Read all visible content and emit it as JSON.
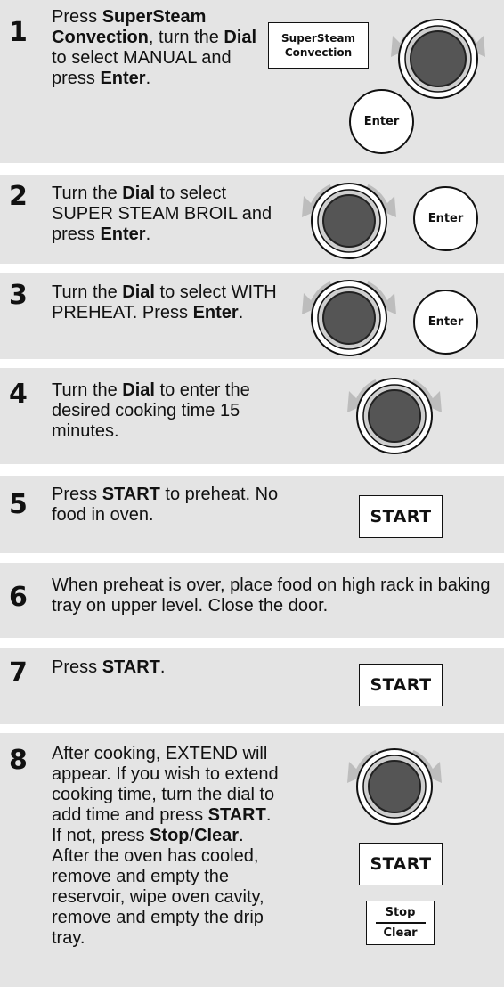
{
  "steps": [
    {
      "number": "1",
      "parts": [
        "Press ",
        "SuperSteam Convection",
        ", turn the ",
        "Dial",
        " to select MANUAL and press ",
        "Enter",
        "."
      ]
    },
    {
      "number": "2",
      "parts": [
        "Turn the ",
        "Dial",
        " to select SUPER STEAM BROIL and press ",
        "Enter",
        "."
      ]
    },
    {
      "number": "3",
      "parts": [
        "Turn the ",
        "Dial",
        " to select WITH PREHEAT. Press ",
        "Enter",
        "."
      ]
    },
    {
      "number": "4",
      "parts": [
        "Turn the ",
        "Dial",
        " to enter the desired cooking time 15 minutes."
      ]
    },
    {
      "number": "5",
      "parts": [
        "Press ",
        "START",
        " to preheat. No food in oven."
      ]
    },
    {
      "number": "6",
      "parts": [
        "When preheat is over, place food on high rack in baking tray on upper level. Close the door."
      ]
    },
    {
      "number": "7",
      "parts": [
        "Press ",
        "START",
        "."
      ]
    },
    {
      "number": "8",
      "parts": [
        "After cooking, EXTEND will appear. If you wish to extend cooking time, turn the dial to add time and press ",
        "START",
        ".",
        "\nIf not, press ",
        "Stop",
        "/",
        "Clear",
        ". After the oven has cooled, remove and empty the reservoir, wipe oven cavity, remove and empty the drip tray."
      ]
    }
  ],
  "buttons": {
    "supersteam_line1": "SuperSteam",
    "supersteam_line2": "Convection",
    "enter": "Enter",
    "start": "START",
    "stop": "Stop",
    "clear": "Clear"
  },
  "icons": {
    "dial": "rotary-dial-icon"
  },
  "colors": {
    "panel": "#e4e4e4",
    "dial_face": "#555555",
    "arrow": "#bdbdbd"
  }
}
